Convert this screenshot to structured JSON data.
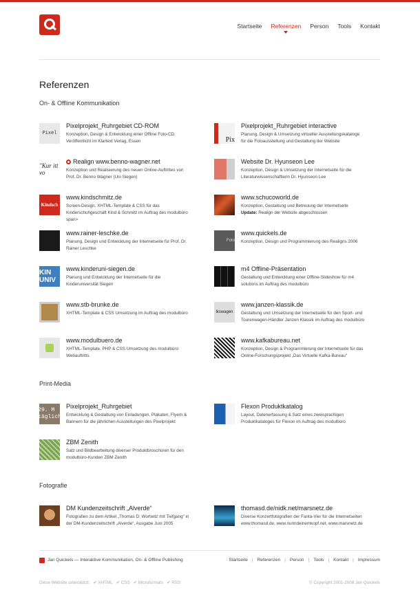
{
  "nav": {
    "items": [
      {
        "label": "Startseite"
      },
      {
        "label": "Referenzen"
      },
      {
        "label": "Person"
      },
      {
        "label": "Tools"
      },
      {
        "label": "Kontakt"
      }
    ],
    "active_index": 1
  },
  "page": {
    "title": "Referenzen"
  },
  "sections": [
    {
      "heading": "On- & Offline Kommunikation",
      "items": [
        {
          "title": "Pixelprojekt_Ruhrgebiet CD-ROM",
          "lines": [
            "Konzeption, Design & Entwicklung einer Offline Foto-CD.",
            "Veröffentlicht im Klartext Verlag, Essen"
          ],
          "thumb_text": "Pixel"
        },
        {
          "title": "Pixelprojekt_Ruhrgebiet interactive",
          "lines": [
            "Planung, Design & Umsetzung virtueller Ausstellungskataloge",
            "für die Fotoausstellung und Gestaltung der Website"
          ],
          "thumb_text": "Pix"
        },
        {
          "title": "Realign www.benno-wagner.net",
          "lines": [
            "Konzeption und Realisierung des neuen Online-Auftrittes von",
            "Prof. Dr. Benno Wagner (Uni Siegen)"
          ],
          "thumb_text": "\"Kur itt vo"
        },
        {
          "title": "Website Dr. Hyunseon Lee",
          "lines": [
            "Konzeption, Design & Umsetzung der Internetseite für die",
            "Literaturwissenschaftlerin Dr. Hyunseon Lee"
          ],
          "thumb_text": ""
        },
        {
          "title": "www.kindschmitz.de",
          "lines": [
            "Screen-Design, XHTML-Template & CSS für das",
            "Kinderschuhgeschäft Kind & Schmitz im Auftrag des modulbüro",
            "span>"
          ],
          "thumb_text": "Kindsch"
        },
        {
          "title": "www.schucoworld.de",
          "lines": [
            "Konzeption, Gestaltung und Betreuung der Internetseite"
          ],
          "update_label": "Update:",
          "update_text": "Realign der Website abgeschlossen",
          "thumb_text": ""
        },
        {
          "title": "www.rainer-leschke.de",
          "lines": [
            "Planung, Design und Entwicklung der Internetseite für Prof. Dr.",
            "Rainer Leschke"
          ],
          "thumb_text": ""
        },
        {
          "title": "www.quickels.de",
          "lines": [
            "Konzeption, Design und Programmierung des Realigns 2006"
          ],
          "thumb_text": "Foto"
        },
        {
          "title": "www.kinderuni-siegen.de",
          "lines": [
            "Planung und Entwicklung der Internetseite für die",
            "Kinderuniversität Siegen"
          ],
          "thumb_text": "KIN UNIV"
        },
        {
          "title": "m4 Offline-Präsentation",
          "lines": [
            "Gestaltung und Entwicklung einer Offline-Slideshow für m4",
            "solutions im Auftrag des modulbüro"
          ],
          "thumb_text": ""
        },
        {
          "title": "www.stb-brunke.de",
          "lines": [
            "XHTML-Template & CSS Umsetzung im Auftrag des modulbüro"
          ],
          "thumb_text": ""
        },
        {
          "title": "www.janzen-klassik.de",
          "lines": [
            "Gestaltung und Umsetzung der Internetseite für den Sport- und",
            "Tourenwagen-Händler Janzen Klassik im Auftrag des modulbüro"
          ],
          "thumb_text": "lkswagen"
        },
        {
          "title": "www.modulbuero.de",
          "lines": [
            "XHTML-Template, PHP & CSS Umsetzung des modulbüro",
            "Webauftritts"
          ],
          "thumb_text": ""
        },
        {
          "title": "www.kafkabureau.net",
          "lines": [
            "Konzeption, Design & Programmierung der Internetseite für das",
            "Online-Forschungsprojekt „Das Virtuelle Kafka-Bureau“"
          ],
          "thumb_text": ""
        }
      ]
    },
    {
      "heading": "Print-Media",
      "items": [
        {
          "title": "Pixelprojekt_Ruhrgebiet",
          "lines": [
            "Entwicklung & Gestaltung von Einladungen, Plakaten, Flyern &",
            "Bannern für die jährlichen Ausstellungen des Pixelprojekt"
          ],
          "thumb_text": "29. M täglich"
        },
        {
          "title": "Flexon Produktkatalog",
          "lines": [
            "Layout, Datenerfassung & Satz eines zweisprachigen",
            "Produktkataloges für Flexon im Auftrag des modulbüro"
          ],
          "thumb_text": ""
        },
        {
          "title": "ZBM Zenith",
          "lines": [
            "Satz und Bildbearbeitung diverser Produktbroschüren für den",
            "modulbüro-Kunden ZBM Zenith"
          ],
          "thumb_text": ""
        }
      ]
    },
    {
      "heading": "Fotografie",
      "items": [
        {
          "title": "DM Kundenzeitschrift „Alverde“",
          "lines": [
            "Fotografien zu dem Artikel „Thomas D: Wortwitz mit Tiefgang“ in",
            "der DM-Kundenzeitschrift „Alverde“, Ausgabe Juni 2005"
          ],
          "thumb_text": ""
        },
        {
          "title": "thomasd.de/nidk.net/marsnetz.de",
          "lines": [
            "Diverse Konzertfotografien der Fanta-Vier für die Internetseiten",
            "www.thomasd.de, www.nurindeinemkopf.net, www.marsnetz.de"
          ],
          "thumb_text": ""
        }
      ]
    }
  ],
  "footer": {
    "credit": "Jan Quickels — Interaktive Kommunikation, On- & Offline Publishing",
    "links": [
      "Startseite",
      "Referenzen",
      "Person",
      "Tools",
      "Kontakt",
      "Impressum"
    ],
    "support_label": "Diese Website unterstützt:",
    "support_items": [
      "✔ XHTML",
      "✔ CSS",
      "✔ Microformats",
      "✔ RSS"
    ],
    "copyright": "© Copyright 2001-2008 Jan Quickels"
  },
  "colors": {
    "accent": "#cc2a1e",
    "text": "#222222",
    "muted": "#aaaaaa"
  }
}
